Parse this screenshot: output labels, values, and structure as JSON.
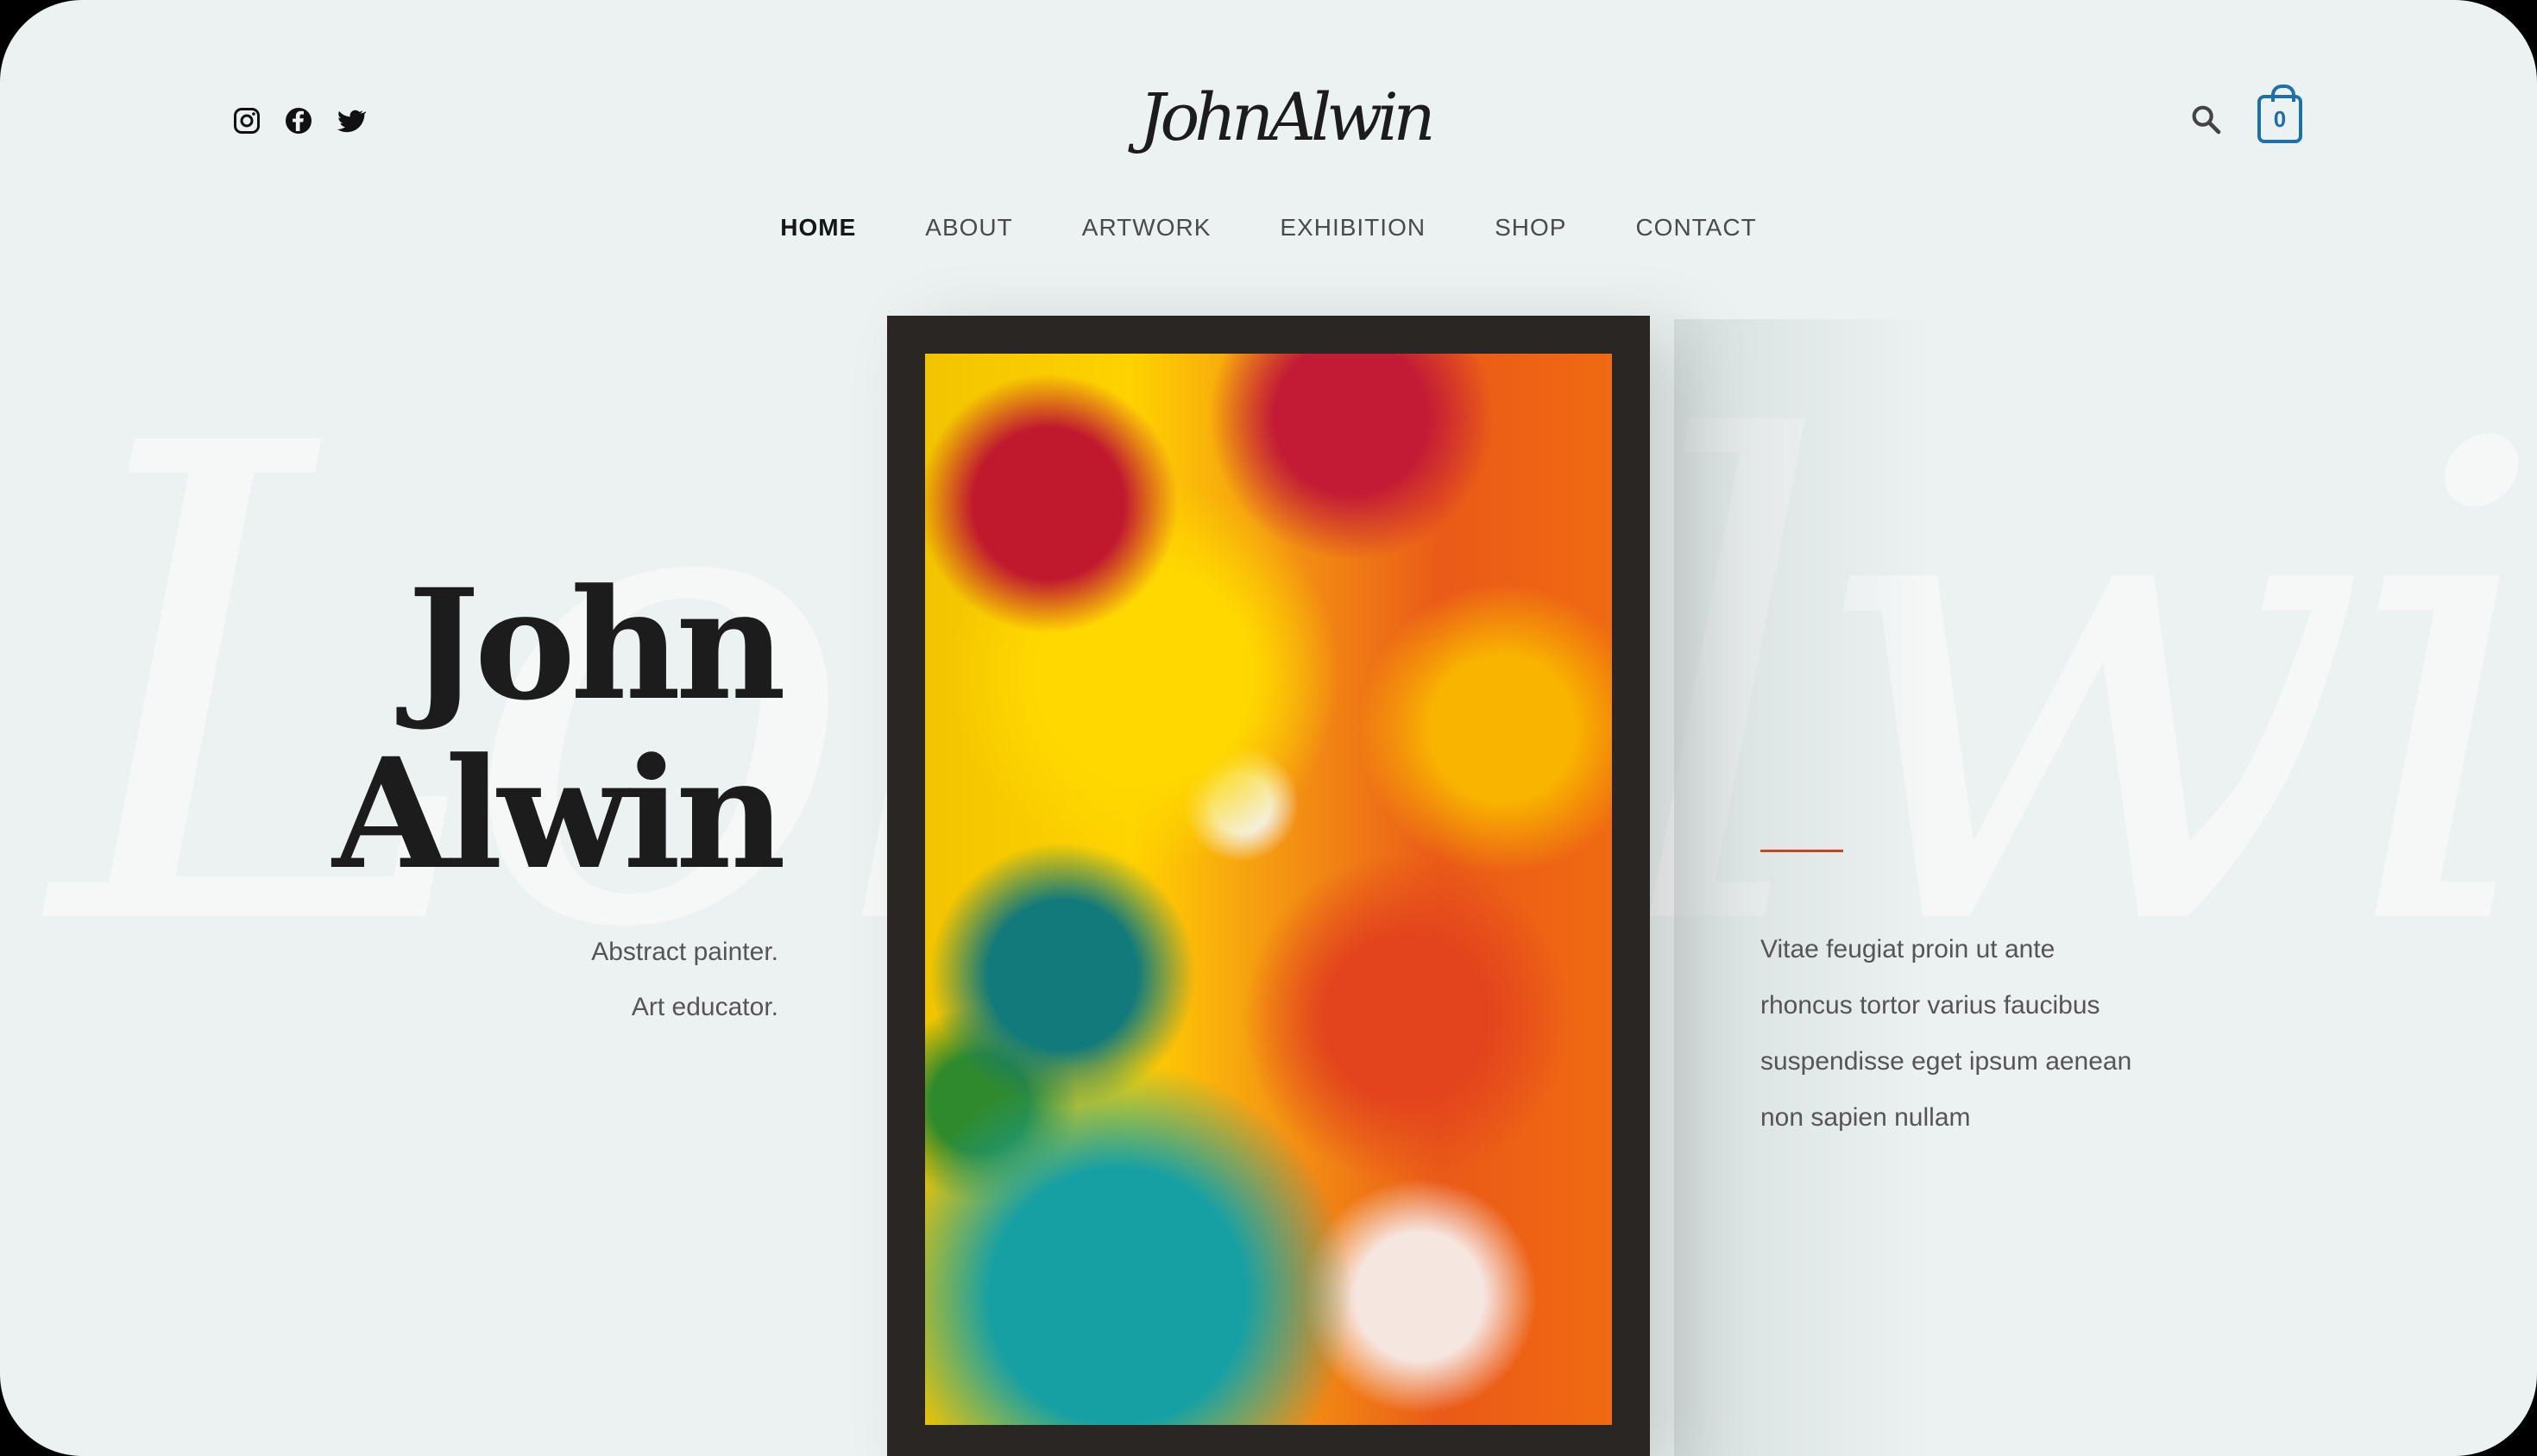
{
  "brand": {
    "logo_text": "JohnAlwin"
  },
  "header": {
    "social": [
      "instagram-icon",
      "facebook-icon",
      "twitter-icon"
    ],
    "cart_count": "0"
  },
  "nav": {
    "items": [
      {
        "label": "HOME",
        "active": true
      },
      {
        "label": "ABOUT"
      },
      {
        "label": "ARTWORK"
      },
      {
        "label": "EXHIBITION"
      },
      {
        "label": "SHOP"
      },
      {
        "label": "CONTACT"
      }
    ]
  },
  "hero": {
    "name_line1": "John",
    "name_line2": "Alwin",
    "tagline1": "Abstract painter.",
    "tagline2": "Art educator.",
    "blurb": [
      "Vitae feugiat proin ut ante",
      "rhoncus tortor varius faucibus",
      "suspendisse eget ipsum aenean",
      "non sapien nullam"
    ]
  },
  "colors": {
    "background": "#ecf2f2",
    "accent": "#c9441f",
    "cart": "#1f6fa8",
    "text": "#1c1c1c"
  }
}
